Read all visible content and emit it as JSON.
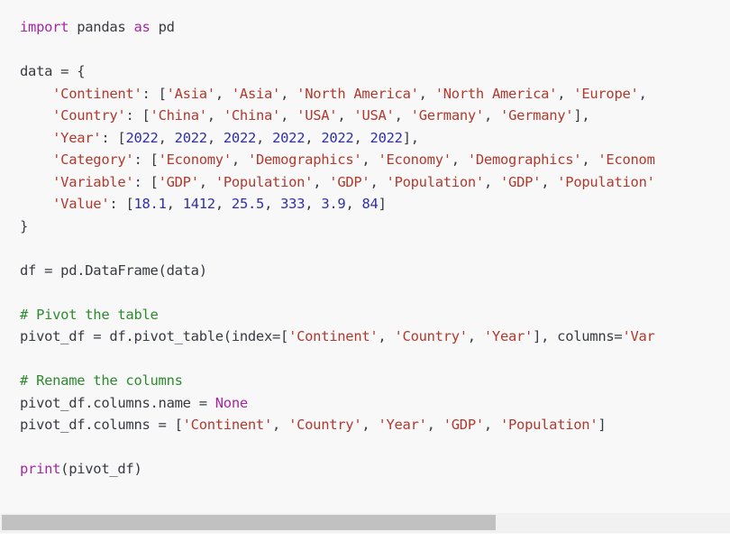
{
  "colors": {
    "background": "#f8f8f8",
    "keyword": "#a626a4",
    "string": "#b03a2e",
    "number": "#2f2fa8",
    "comment": "#2e8b2e",
    "scroll_thumb": "#c1c1c1"
  },
  "scrollbar": {
    "horizontal_visible_fraction": 0.68,
    "position": 0
  },
  "code_lines": [
    [
      {
        "t": "import",
        "c": "kw"
      },
      {
        "t": " pandas "
      },
      {
        "t": "as",
        "c": "kw"
      },
      {
        "t": " pd"
      }
    ],
    [],
    [
      {
        "t": "data = {"
      }
    ],
    [
      {
        "t": "    "
      },
      {
        "t": "'Continent'",
        "c": "str"
      },
      {
        "t": ": ["
      },
      {
        "t": "'Asia'",
        "c": "str"
      },
      {
        "t": ", "
      },
      {
        "t": "'Asia'",
        "c": "str"
      },
      {
        "t": ", "
      },
      {
        "t": "'North America'",
        "c": "str"
      },
      {
        "t": ", "
      },
      {
        "t": "'North America'",
        "c": "str"
      },
      {
        "t": ", "
      },
      {
        "t": "'Europe'",
        "c": "str"
      },
      {
        "t": ", "
      }
    ],
    [
      {
        "t": "    "
      },
      {
        "t": "'Country'",
        "c": "str"
      },
      {
        "t": ": ["
      },
      {
        "t": "'China'",
        "c": "str"
      },
      {
        "t": ", "
      },
      {
        "t": "'China'",
        "c": "str"
      },
      {
        "t": ", "
      },
      {
        "t": "'USA'",
        "c": "str"
      },
      {
        "t": ", "
      },
      {
        "t": "'USA'",
        "c": "str"
      },
      {
        "t": ", "
      },
      {
        "t": "'Germany'",
        "c": "str"
      },
      {
        "t": ", "
      },
      {
        "t": "'Germany'",
        "c": "str"
      },
      {
        "t": "],"
      }
    ],
    [
      {
        "t": "    "
      },
      {
        "t": "'Year'",
        "c": "str"
      },
      {
        "t": ": ["
      },
      {
        "t": "2022",
        "c": "num"
      },
      {
        "t": ", "
      },
      {
        "t": "2022",
        "c": "num"
      },
      {
        "t": ", "
      },
      {
        "t": "2022",
        "c": "num"
      },
      {
        "t": ", "
      },
      {
        "t": "2022",
        "c": "num"
      },
      {
        "t": ", "
      },
      {
        "t": "2022",
        "c": "num"
      },
      {
        "t": ", "
      },
      {
        "t": "2022",
        "c": "num"
      },
      {
        "t": "],"
      }
    ],
    [
      {
        "t": "    "
      },
      {
        "t": "'Category'",
        "c": "str"
      },
      {
        "t": ": ["
      },
      {
        "t": "'Economy'",
        "c": "str"
      },
      {
        "t": ", "
      },
      {
        "t": "'Demographics'",
        "c": "str"
      },
      {
        "t": ", "
      },
      {
        "t": "'Economy'",
        "c": "str"
      },
      {
        "t": ", "
      },
      {
        "t": "'Demographics'",
        "c": "str"
      },
      {
        "t": ", "
      },
      {
        "t": "'Econom",
        "c": "str"
      }
    ],
    [
      {
        "t": "    "
      },
      {
        "t": "'Variable'",
        "c": "str"
      },
      {
        "t": ": ["
      },
      {
        "t": "'GDP'",
        "c": "str"
      },
      {
        "t": ", "
      },
      {
        "t": "'Population'",
        "c": "str"
      },
      {
        "t": ", "
      },
      {
        "t": "'GDP'",
        "c": "str"
      },
      {
        "t": ", "
      },
      {
        "t": "'Population'",
        "c": "str"
      },
      {
        "t": ", "
      },
      {
        "t": "'GDP'",
        "c": "str"
      },
      {
        "t": ", "
      },
      {
        "t": "'Population'",
        "c": "str"
      }
    ],
    [
      {
        "t": "    "
      },
      {
        "t": "'Value'",
        "c": "str"
      },
      {
        "t": ": ["
      },
      {
        "t": "18.1",
        "c": "num"
      },
      {
        "t": ", "
      },
      {
        "t": "1412",
        "c": "num"
      },
      {
        "t": ", "
      },
      {
        "t": "25.5",
        "c": "num"
      },
      {
        "t": ", "
      },
      {
        "t": "333",
        "c": "num"
      },
      {
        "t": ", "
      },
      {
        "t": "3.9",
        "c": "num"
      },
      {
        "t": ", "
      },
      {
        "t": "84",
        "c": "num"
      },
      {
        "t": "]"
      }
    ],
    [
      {
        "t": "}"
      }
    ],
    [],
    [
      {
        "t": "df = pd.DataFrame(data)"
      }
    ],
    [],
    [
      {
        "t": "# Pivot the table",
        "c": "com"
      }
    ],
    [
      {
        "t": "pivot_df = df.pivot_table(index=["
      },
      {
        "t": "'Continent'",
        "c": "str"
      },
      {
        "t": ", "
      },
      {
        "t": "'Country'",
        "c": "str"
      },
      {
        "t": ", "
      },
      {
        "t": "'Year'",
        "c": "str"
      },
      {
        "t": "], columns="
      },
      {
        "t": "'Var",
        "c": "str"
      }
    ],
    [],
    [
      {
        "t": "# Rename the columns",
        "c": "com"
      }
    ],
    [
      {
        "t": "pivot_df.columns.name = "
      },
      {
        "t": "None",
        "c": "kw"
      }
    ],
    [
      {
        "t": "pivot_df.columns = ["
      },
      {
        "t": "'Continent'",
        "c": "str"
      },
      {
        "t": ", "
      },
      {
        "t": "'Country'",
        "c": "str"
      },
      {
        "t": ", "
      },
      {
        "t": "'Year'",
        "c": "str"
      },
      {
        "t": ", "
      },
      {
        "t": "'GDP'",
        "c": "str"
      },
      {
        "t": ", "
      },
      {
        "t": "'Population'",
        "c": "str"
      },
      {
        "t": "]"
      }
    ],
    [],
    [
      {
        "t": "print",
        "c": "kw"
      },
      {
        "t": "(pivot_df)"
      }
    ]
  ]
}
